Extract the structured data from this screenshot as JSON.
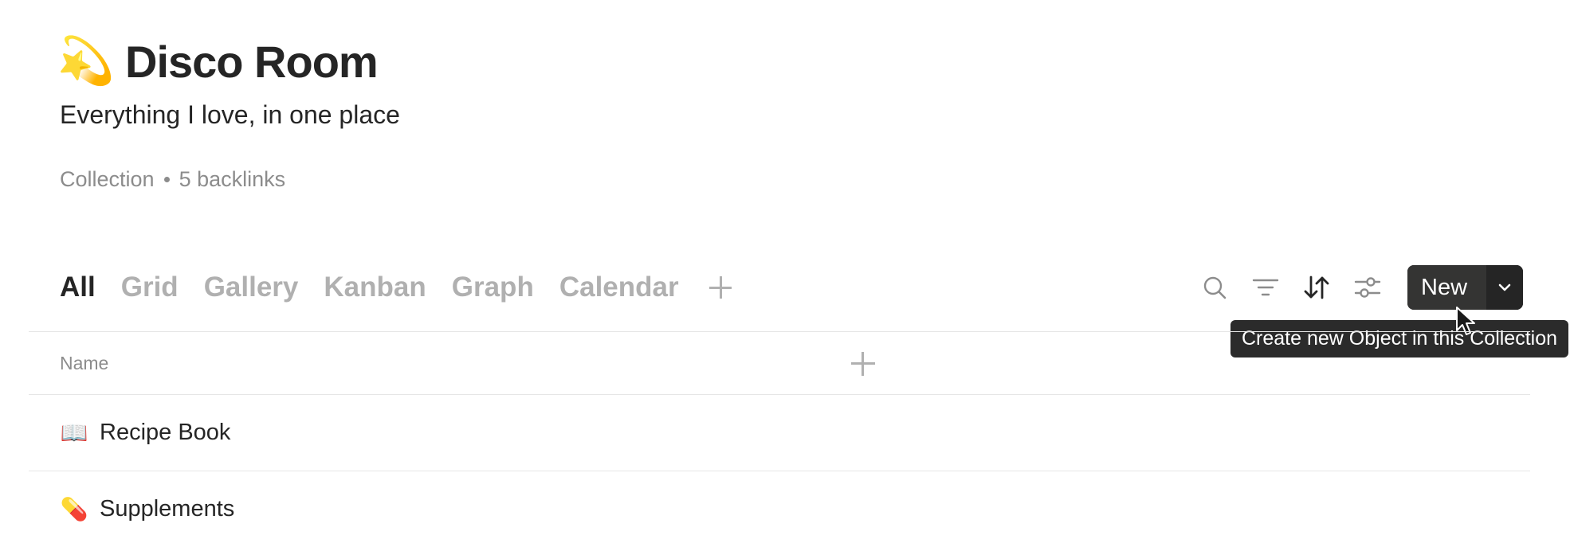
{
  "header": {
    "emoji": "💫",
    "title": "Disco Room",
    "description": "Everything I love, in one place",
    "type_label": "Collection",
    "backlinks": "5 backlinks"
  },
  "views": {
    "tabs": [
      {
        "label": "All",
        "active": true
      },
      {
        "label": "Grid",
        "active": false
      },
      {
        "label": "Gallery",
        "active": false
      },
      {
        "label": "Kanban",
        "active": false
      },
      {
        "label": "Graph",
        "active": false
      },
      {
        "label": "Calendar",
        "active": false
      }
    ],
    "add_icon": "plus-icon"
  },
  "toolbar": {
    "icons": [
      "search-icon",
      "filter-icon",
      "sort-icon",
      "settings-sliders-icon"
    ],
    "new_label": "New",
    "dropdown_icon": "chevron-down-icon",
    "tooltip": "Create new Object in this Collection"
  },
  "table": {
    "columns": [
      "Name"
    ],
    "rows": [
      {
        "emoji": "📖",
        "name": "Recipe Book"
      },
      {
        "emoji": "💊",
        "name": "Supplements"
      }
    ]
  },
  "colors": {
    "text": "#252525",
    "muted": "#8c8c8c",
    "inactive_tab": "#b0b0b0",
    "button_bg": "#343433",
    "border": "#e6e6e6"
  }
}
